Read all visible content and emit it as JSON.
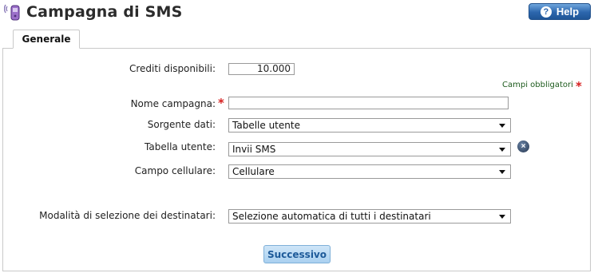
{
  "header": {
    "title": "Campagna di SMS",
    "help_label": "Help",
    "help_glyph": "?"
  },
  "tabs": [
    {
      "label": "Generale",
      "active": true
    }
  ],
  "form": {
    "credits_label": "Crediti disponibili:",
    "credits_value": "10.000",
    "mandatory_note": "Campi obbligatori",
    "required_mark": "*",
    "campaign_name_label": "Nome campagna:",
    "campaign_name_value": "",
    "data_source_label": "Sorgente dati:",
    "data_source_value": "Tabelle utente",
    "user_table_label": "Tabella utente:",
    "user_table_value": "Invii SMS",
    "clear_glyph": "×",
    "phone_field_label": "Campo cellulare:",
    "phone_field_value": "Cellulare",
    "selection_mode_label": "Modalità di selezione dei destinatari:",
    "selection_mode_value": "Selezione automatica di tutti i destinatari",
    "next_label": "Successivo"
  },
  "colors": {
    "help_button": "#2c66ad",
    "required": "#d61f1f",
    "mandatory_note": "#1c5a1c",
    "next_button": "#a9d0f0"
  }
}
